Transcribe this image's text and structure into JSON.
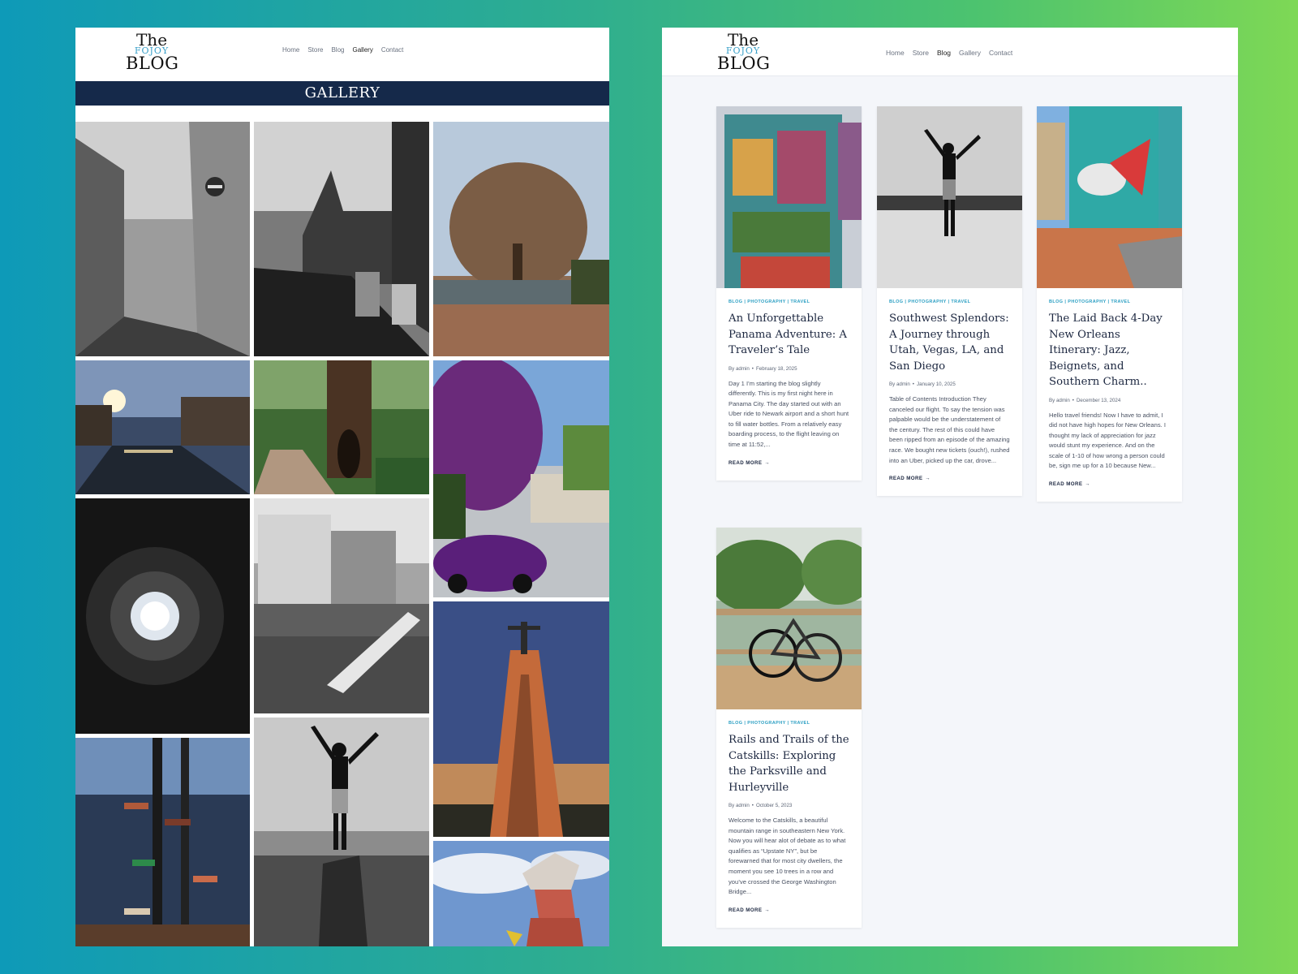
{
  "gallery_page": {
    "logo": {
      "line1": "The",
      "line2": "FOJOY",
      "line3": "BLOG"
    },
    "nav": [
      "Home",
      "Store",
      "Blog",
      "Gallery",
      "Contact"
    ],
    "active_nav": "Gallery",
    "banner_title": "GALLERY"
  },
  "blog_page": {
    "logo": {
      "line1": "The",
      "line2": "FOJOY",
      "line3": "BLOG"
    },
    "nav": [
      "Home",
      "Store",
      "Blog",
      "Gallery",
      "Contact"
    ],
    "active_nav": "Blog",
    "posts": [
      {
        "categories": "BLOG | PHOTOGRAPHY | TRAVEL",
        "title": "An Unforgettable Panama Adventure: A Traveler’s Tale",
        "author": "By admin",
        "date": "February 18, 2025",
        "excerpt": "Day 1 I’m starting the blog slightly differently. This is my first night here in Panama City. The day started out with an Uber ride to Newark airport and a short hunt to fill water bottles. From a relatively easy boarding process, to the flight leaving on time at 11:52,...",
        "read_more": "READ MORE"
      },
      {
        "categories": "BLOG | PHOTOGRAPHY | TRAVEL",
        "title": "Southwest Splendors: A Journey through Utah, Vegas, LA, and San Diego",
        "author": "By admin",
        "date": "January 10, 2025",
        "excerpt": "Table of Contents Introduction They canceled our flight.  To say the tension was palpable would be the understatement of the century. The rest of this could have been ripped from an episode of the amazing race. We bought new tickets (ouch!), rushed into an Uber, picked up the car, drove...",
        "read_more": "READ MORE"
      },
      {
        "categories": "BLOG | PHOTOGRAPHY | TRAVEL",
        "title": "The Laid Back 4-Day New Orleans Itinerary: Jazz, Beignets, and Southern Charm..",
        "author": "By admin",
        "date": "December 13, 2024",
        "excerpt": "Hello travel friends! Now I have to admit, I did not have high hopes for New Orleans. I thought my lack of appreciation  for jazz would stunt my experience. And on the scale of 1-10 of how wrong a person could be, sign me up for a 10 because New...",
        "read_more": "READ MORE"
      },
      {
        "categories": "BLOG | PHOTOGRAPHY | TRAVEL",
        "title": "Rails and Trails of the Catskills: Exploring the Parksville and Hurleyville",
        "author": "By admin",
        "date": "October 5, 2023",
        "excerpt": "Welcome to the Catskills, a beautiful mountain range in southeastern New York. Now you will hear alot of debate as to what qualifies as “Upstate NY”, but be forewarned that for most city dwellers, the moment you see 10 trees in a row and you’ve crossed the George Washington Bridge...",
        "read_more": "READ MORE"
      }
    ]
  }
}
